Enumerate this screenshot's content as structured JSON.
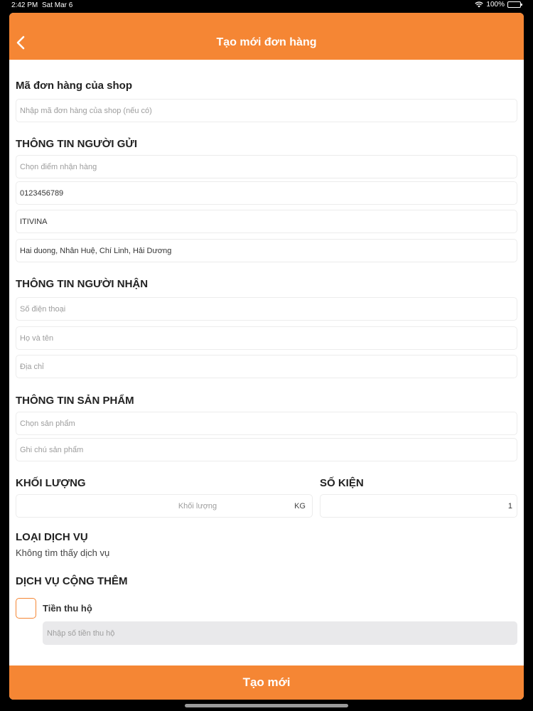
{
  "status_bar": {
    "time": "2:42 PM",
    "date": "Sat Mar 6",
    "battery": "100%"
  },
  "header": {
    "title": "Tạo mới đơn hàng"
  },
  "shop_order": {
    "title": "Mã đơn hàng của shop",
    "placeholder": "Nhập mã đơn hàng của shop (nếu có)"
  },
  "sender": {
    "title": "THÔNG TIN NGƯỜI GỬI",
    "pickup_placeholder": "Chọn điểm nhận hàng",
    "phone": "0123456789",
    "name": "ITIVINA",
    "address": "Hai duong, Nhân Huệ, Chí Linh, Hải Dương"
  },
  "receiver": {
    "title": "THÔNG TIN NGƯỜI NHẬN",
    "phone_placeholder": "Số điện thoại",
    "name_placeholder": "Họ và tên",
    "address_placeholder": "Địa chỉ"
  },
  "product": {
    "title": "THÔNG TIN SẢN PHẨM",
    "select_placeholder": "Chọn sản phẩm",
    "note_placeholder": "Ghi chú sản phẩm"
  },
  "weight": {
    "title": "KHỐI LƯỢNG",
    "placeholder": "Khối lượng",
    "unit": "KG"
  },
  "packages": {
    "title": "SỐ KIỆN",
    "value": "1"
  },
  "service": {
    "title": "LOẠI DỊCH VỤ",
    "empty_text": "Không tìm thấy dịch vụ"
  },
  "extra_service": {
    "title": "DỊCH VỤ CỘNG THÊM",
    "cod_label": "Tiền thu hộ",
    "cod_placeholder": "Nhập số tiền thu hộ"
  },
  "submit_label": "Tạo mới",
  "colors": {
    "accent": "#f58634"
  }
}
